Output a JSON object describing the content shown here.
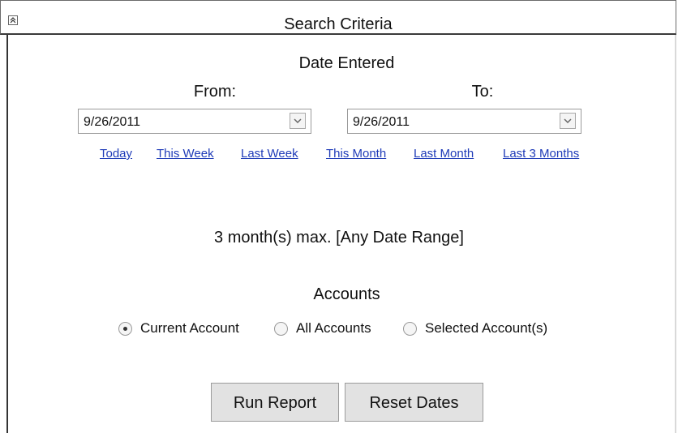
{
  "header": {
    "title": "Search Criteria",
    "collapse_icon": "collapse-up-icon"
  },
  "date_section": {
    "title": "Date Entered",
    "from_label": "From:",
    "to_label": "To:",
    "from_value": "9/26/2011",
    "to_value": "9/26/2011",
    "quick_links": [
      "Today",
      "This Week",
      "Last Week",
      "This Month",
      "Last Month",
      "Last 3 Months"
    ],
    "range_note": "3 month(s) max. [Any Date Range]"
  },
  "accounts": {
    "title": "Accounts",
    "options": [
      {
        "label": "Current Account",
        "selected": true
      },
      {
        "label": "All Accounts",
        "selected": false
      },
      {
        "label": "Selected Account(s)",
        "selected": false
      }
    ]
  },
  "buttons": {
    "run_report": "Run Report",
    "reset_dates": "Reset Dates"
  },
  "colors": {
    "link": "#1f3bb8",
    "button_bg": "#e2e2e2",
    "border_dark": "#333333",
    "border_light": "#9b9b9b"
  }
}
